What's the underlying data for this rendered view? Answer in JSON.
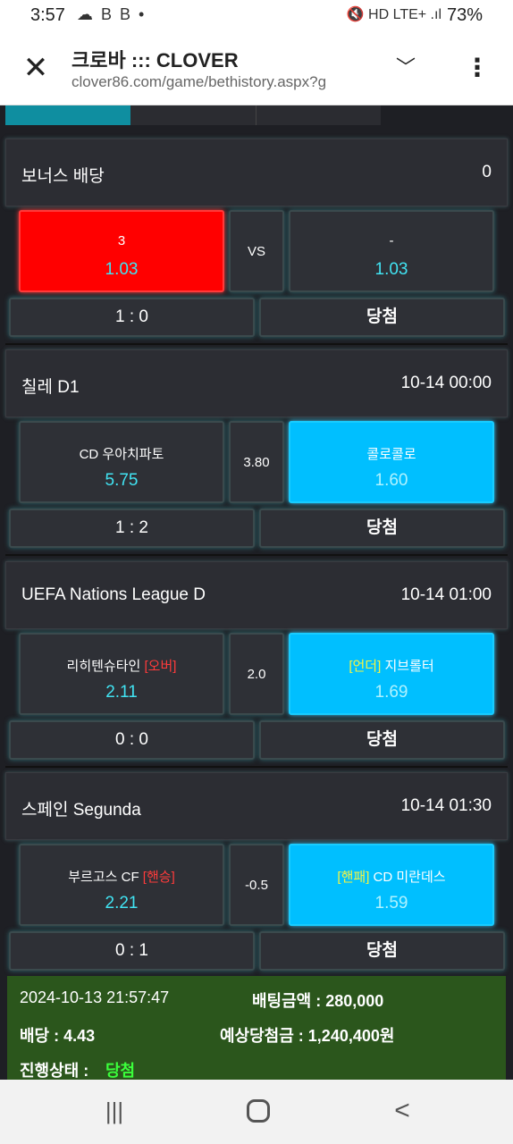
{
  "status_bar": {
    "time": "3:57",
    "left_icons": "☁ B B •",
    "right_icons": "🔇 HD LTE+ .ıl",
    "battery": "73%"
  },
  "browser": {
    "title": "크로바 ::: CLOVER",
    "url": "clover86.com/game/bethistory.aspx?g"
  },
  "games": [
    {
      "league": "보너스 배당",
      "time": "0",
      "home": {
        "name": "3",
        "tag": "",
        "odd": "1.03"
      },
      "mid": "VS",
      "away": {
        "name": "-",
        "tag": "",
        "odd": "1.03"
      },
      "score": "1 : 0",
      "result": "당첨"
    },
    {
      "league": "칠레 D1",
      "time": "10-14 00:00",
      "home": {
        "name": "CD 우아치파토",
        "tag": "",
        "odd": "5.75"
      },
      "mid": "3.80",
      "away": {
        "name": "콜로콜로",
        "tag": "",
        "odd": "1.60"
      },
      "score": "1 : 2",
      "result": "당첨"
    },
    {
      "league": "UEFA Nations League D",
      "time": "10-14 01:00",
      "home": {
        "name": "리히텐슈타인",
        "tag": "[오버]",
        "odd": "2.11"
      },
      "mid": "2.0",
      "away": {
        "name": "지브롤터",
        "tag": "[언더]",
        "odd": "1.69"
      },
      "score": "0 : 0",
      "result": "당첨"
    },
    {
      "league": "스페인 Segunda",
      "time": "10-14 01:30",
      "home": {
        "name": "부르고스 CF",
        "tag": "[핸승]",
        "odd": "2.21"
      },
      "mid": "-0.5",
      "away": {
        "name": "CD 미란데스",
        "tag": "[핸패]",
        "odd": "1.59"
      },
      "score": "0 : 1",
      "result": "당첨"
    }
  ],
  "summary": {
    "datetime": "2024-10-13 21:57:47",
    "bet_amount": "배팅금액 : 280,000",
    "odds": "배당 : 4.43",
    "expected": "예상당첨금 : 1,240,400원",
    "status_label": "진행상태 :",
    "status_value": "당첨"
  },
  "colors": {
    "selected_red": "#ff0000",
    "selected_cyan": "#00bfff",
    "odd_cyan": "#41e3f2",
    "summary_green": "#2b561c",
    "win_green": "#3bff3b"
  }
}
